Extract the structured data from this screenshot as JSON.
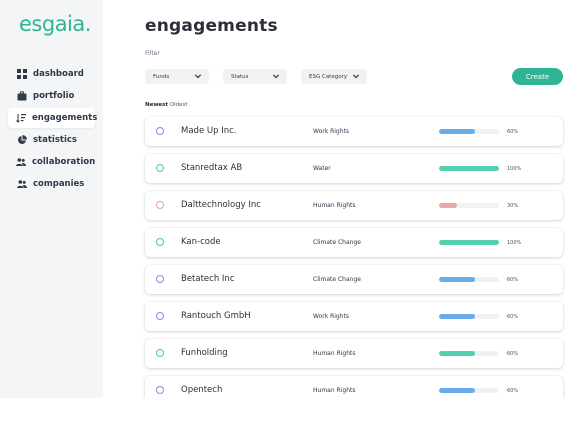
{
  "app": {
    "logo": "esgaia."
  },
  "sidebar": {
    "items": [
      {
        "label": "dashboard",
        "icon": "grid-icon",
        "active": false
      },
      {
        "label": "portfolio",
        "icon": "briefcase-icon",
        "active": false
      },
      {
        "label": "engagements",
        "icon": "sort-icon",
        "active": true
      },
      {
        "label": "statistics",
        "icon": "pie-chart-icon",
        "active": false
      },
      {
        "label": "collaboration",
        "icon": "users-icon",
        "active": false
      },
      {
        "label": "companies",
        "icon": "users-icon",
        "active": false
      }
    ]
  },
  "page": {
    "title": "engagements"
  },
  "filters": {
    "label": "Filter",
    "items": [
      {
        "label": "Funds"
      },
      {
        "label": "Status"
      },
      {
        "label": "ESG Category"
      }
    ]
  },
  "actions": {
    "create_label": "Create"
  },
  "sort": {
    "newest": "Newest",
    "oldest": "Oldest",
    "active": "newest"
  },
  "colors": {
    "brand": "#2fb593",
    "governance": "#7c95d6",
    "environment": "#45c9a8",
    "social": "#e9a4a8",
    "bar_blue": "#6aabea",
    "bar_green": "#52cfb0",
    "bar_red": "#e8a6a8"
  },
  "engagements": [
    {
      "company": "Made Up Inc.",
      "topic": "Work Rights",
      "progress": 60,
      "progress_label": "60%",
      "category": "blue"
    },
    {
      "company": "Stanredtax AB",
      "topic": "Water",
      "progress": 100,
      "progress_label": "100%",
      "category": "green"
    },
    {
      "company": "Dalttechnology Inc",
      "topic": "Human Rights",
      "progress": 30,
      "progress_label": "30%",
      "category": "red"
    },
    {
      "company": "Kan-code",
      "topic": "Climate Change",
      "progress": 100,
      "progress_label": "100%",
      "category": "green"
    },
    {
      "company": "Betatech Inc",
      "topic": "Climate Change",
      "progress": 60,
      "progress_label": "60%",
      "category": "blue"
    },
    {
      "company": "Rantouch GmbH",
      "topic": "Work Rights",
      "progress": 60,
      "progress_label": "60%",
      "category": "blue"
    },
    {
      "company": "Funholding",
      "topic": "Human Rights",
      "progress": 60,
      "progress_label": "60%",
      "category": "green"
    },
    {
      "company": "Opentech",
      "topic": "Human Rights",
      "progress": 60,
      "progress_label": "60%",
      "category": "blue"
    }
  ]
}
